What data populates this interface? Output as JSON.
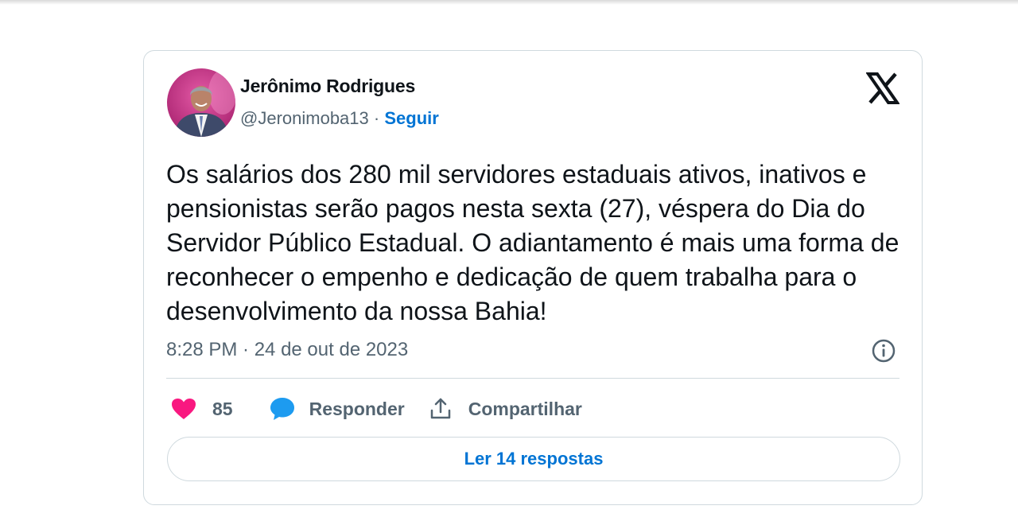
{
  "tweet": {
    "author_name": "Jerônimo Rodrigues",
    "handle": "@Jeronimoba13",
    "separator": "·",
    "follow_label": "Seguir",
    "text": "Os salários dos 280 mil servidores estaduais ativos, inativos e pensionistas serão pagos nesta sexta (27), véspera do Dia do Servidor Público Estadual. O adiantamento é mais uma forma de reconhecer o empenho e dedicação de quem trabalha para o desenvolvimento da nossa Bahia!",
    "timestamp": "8:28 PM · 24 de out de 2023",
    "likes_count": "85",
    "reply_label": "Responder",
    "share_label": "Compartilhar",
    "read_replies_label": "Ler 14 respostas"
  },
  "icons": {
    "logo": "x-logo-icon",
    "info": "info-icon",
    "like": "heart-icon",
    "reply": "speech-bubble-icon",
    "share": "share-upload-icon"
  },
  "colors": {
    "link": "#0074d4",
    "heart": "#f91880",
    "reply": "#1d9bf0",
    "muted_text": "#536471",
    "border": "#cfd9de",
    "avatar_bg": "#c2337e"
  }
}
